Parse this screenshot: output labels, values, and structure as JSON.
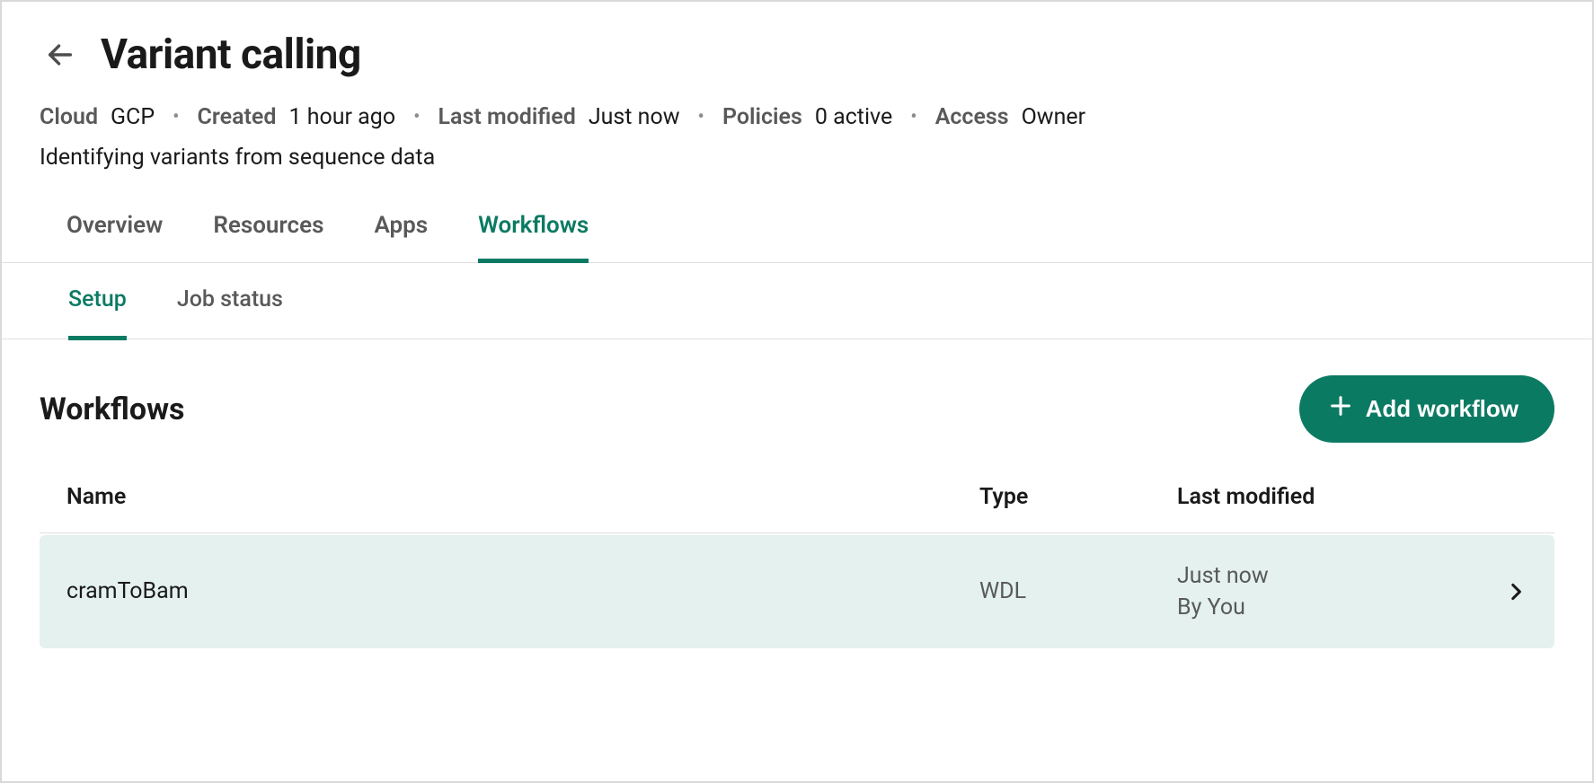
{
  "header": {
    "title": "Variant calling"
  },
  "meta": {
    "cloud_label": "Cloud",
    "cloud_value": "GCP",
    "created_label": "Created",
    "created_value": "1 hour ago",
    "lastmod_label": "Last modified",
    "lastmod_value": "Just now",
    "policies_label": "Policies",
    "policies_value": "0 active",
    "access_label": "Access",
    "access_value": "Owner"
  },
  "description": "Identifying variants from sequence data",
  "primary_tabs": {
    "overview": "Overview",
    "resources": "Resources",
    "apps": "Apps",
    "workflows": "Workflows"
  },
  "secondary_tabs": {
    "setup": "Setup",
    "job_status": "Job status"
  },
  "section": {
    "title": "Workflows",
    "add_button_label": "Add workflow"
  },
  "table": {
    "headers": {
      "name": "Name",
      "type": "Type",
      "last_modified": "Last modified"
    },
    "rows": [
      {
        "name": "cramToBam",
        "type": "WDL",
        "last_modified_time": "Just now",
        "last_modified_by": "By You"
      }
    ]
  }
}
